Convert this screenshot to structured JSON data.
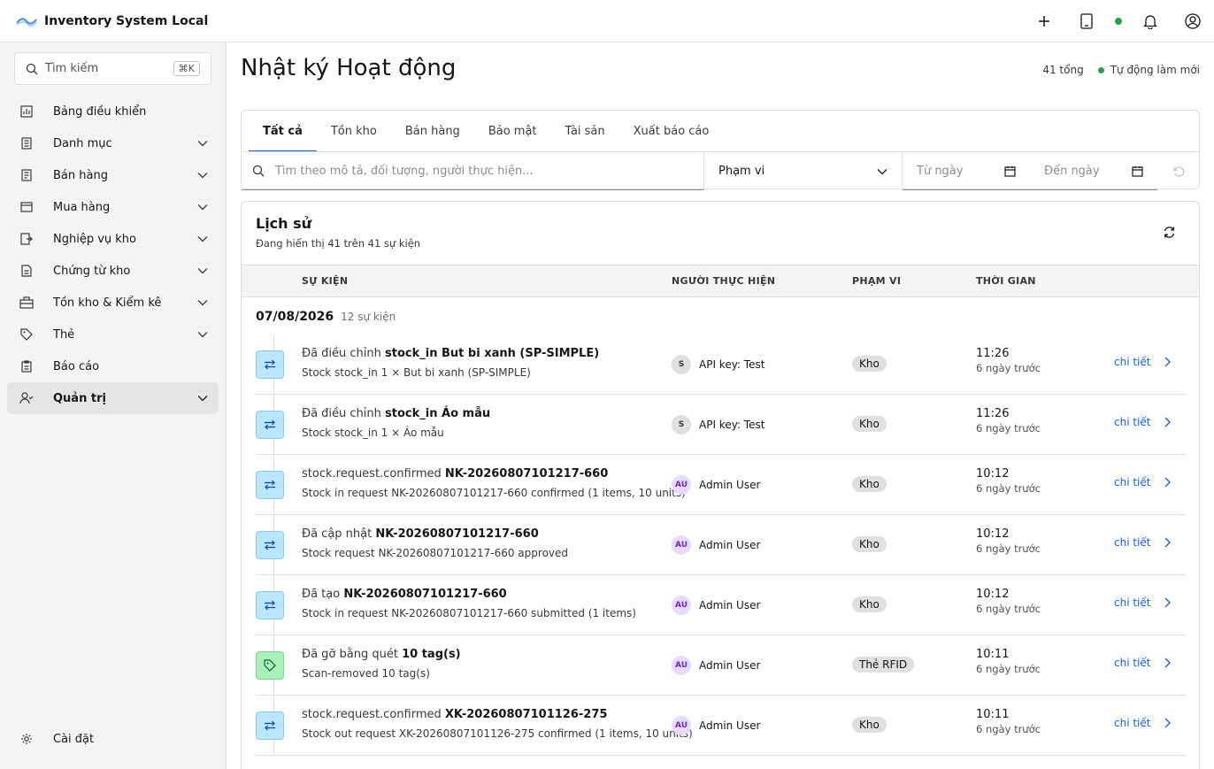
{
  "header": {
    "app_title": "Inventory System Local",
    "actions": [
      "add-icon",
      "tablet-icon",
      "status-dot",
      "notification-icon",
      "user-avatar-icon"
    ]
  },
  "sidebar": {
    "search_placeholder": "Tìm kiếm",
    "search_shortcut": "⌘K",
    "items": [
      {
        "label": "Bảng điều khiển",
        "icon": "dashboard-icon",
        "expandable": false
      },
      {
        "label": "Danh mục",
        "icon": "catalog-icon",
        "expandable": true
      },
      {
        "label": "Bán hàng",
        "icon": "sales-icon",
        "expandable": true
      },
      {
        "label": "Mua hàng",
        "icon": "purchase-icon",
        "expandable": true
      },
      {
        "label": "Nghiệp vụ kho",
        "icon": "warehouse-ops-icon",
        "expandable": true
      },
      {
        "label": "Chứng từ kho",
        "icon": "document-icon",
        "expandable": true
      },
      {
        "label": "Tồn kho & Kiểm kê",
        "icon": "inventory-icon",
        "expandable": true
      },
      {
        "label": "Thẻ",
        "icon": "tag-icon",
        "expandable": true
      },
      {
        "label": "Báo cáo",
        "icon": "report-icon",
        "expandable": false
      },
      {
        "label": "Quản trị",
        "icon": "admin-icon",
        "expandable": true,
        "active": true
      }
    ],
    "settings_label": "Cài đặt"
  },
  "main": {
    "title": "Nhật ký Hoạt động",
    "total": "41 tổng",
    "auto_refresh": "Tự động làm mới",
    "tabs": [
      {
        "label": "Tất cả",
        "active": true
      },
      {
        "label": "Tồn kho"
      },
      {
        "label": "Bán hàng"
      },
      {
        "label": "Bảo mật"
      },
      {
        "label": "Tài sản"
      },
      {
        "label": "Xuất báo cáo"
      }
    ],
    "filters": {
      "search_placeholder": "Tìm theo mô tả, đối tượng, người thực hiện...",
      "scope_label": "Phạm vi",
      "from_date": "Từ ngày",
      "to_date": "Đến ngày"
    }
  },
  "history": {
    "title": "Lịch sử",
    "subtitle": "Đang hiển thị 41 trên 41 sự kiện",
    "columns": {
      "event": "SỰ KIỆN",
      "actor": "NGƯỜI THỰC HIỆN",
      "scope": "PHẠM VI",
      "time": "THỜI GIAN"
    },
    "group_date": "07/08/2026",
    "group_count": "12 sự kiện",
    "detail_label": "chi tiết",
    "rows": [
      {
        "icon": "transfer-icon",
        "color": "blue",
        "prefix": "Đã điều chỉnh",
        "object": "stock_in But bi xanh (SP-SIMPLE)",
        "desc": "Stock stock_in 1 × But bi xanh (SP-SIMPLE)",
        "avatar": "S",
        "actor": "API key: Test",
        "scope": "Kho",
        "time": "11:26",
        "ago": "6 ngày trước"
      },
      {
        "icon": "transfer-icon",
        "color": "blue",
        "prefix": "Đã điều chỉnh",
        "object": "stock_in Áo mẫu",
        "desc": "Stock stock_in 1 × Áo mẫu",
        "avatar": "S",
        "actor": "API key: Test",
        "scope": "Kho",
        "time": "11:26",
        "ago": "6 ngày trước"
      },
      {
        "icon": "transfer-icon",
        "color": "blue",
        "prefix": "stock.request.confirmed",
        "object": "NK-20260807101217-660",
        "desc": "Stock in request NK-20260807101217-660 confirmed (1 items, 10 units)",
        "avatar": "AU",
        "actor": "Admin User",
        "scope": "Kho",
        "time": "10:12",
        "ago": "6 ngày trước"
      },
      {
        "icon": "transfer-icon",
        "color": "blue",
        "prefix": "Đã cập nhật",
        "object": "NK-20260807101217-660",
        "desc": "Stock request NK-20260807101217-660 approved",
        "avatar": "AU",
        "actor": "Admin User",
        "scope": "Kho",
        "time": "10:12",
        "ago": "6 ngày trước"
      },
      {
        "icon": "transfer-icon",
        "color": "blue",
        "prefix": "Đã tạo",
        "object": "NK-20260807101217-660",
        "desc": "Stock in request NK-20260807101217-660 submitted (1 items)",
        "avatar": "AU",
        "actor": "Admin User",
        "scope": "Kho",
        "time": "10:12",
        "ago": "6 ngày trước"
      },
      {
        "icon": "tag-icon",
        "color": "green",
        "prefix": "Đã gỡ bằng quét",
        "object": "10 tag(s)",
        "desc": "Scan-removed 10 tag(s)",
        "avatar": "AU",
        "actor": "Admin User",
        "scope": "Thẻ RFID",
        "time": "10:11",
        "ago": "6 ngày trước"
      },
      {
        "icon": "transfer-icon",
        "color": "blue",
        "prefix": "stock.request.confirmed",
        "object": "XK-20260807101126-275",
        "desc": "Stock out request XK-20260807101126-275 confirmed (1 items, 10 units)",
        "avatar": "AU",
        "actor": "Admin User",
        "scope": "Kho",
        "time": "10:11",
        "ago": "6 ngày trước"
      }
    ]
  }
}
